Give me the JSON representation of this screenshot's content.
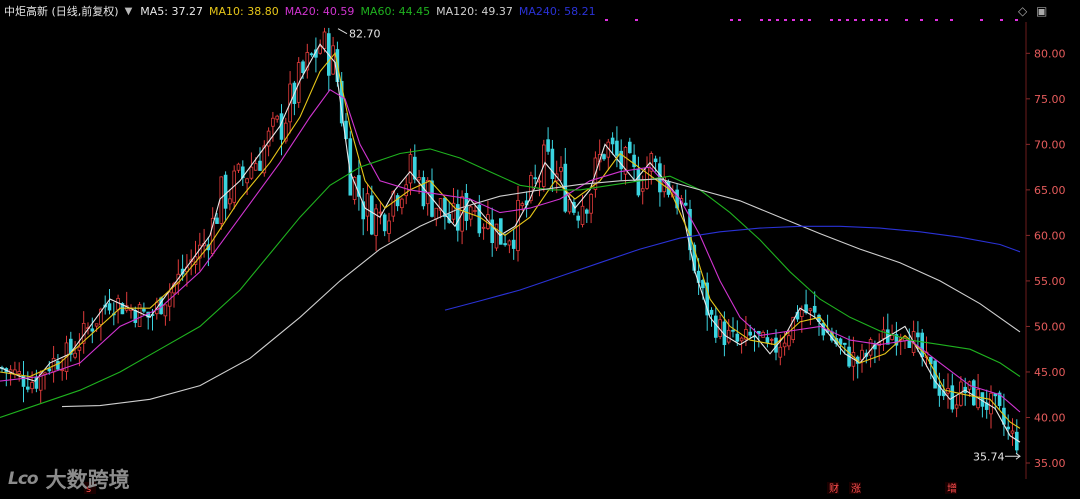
{
  "header": {
    "stock_name": "中炬高新 (日线,前复权)",
    "ma": [
      {
        "label": "MA5: 37.27",
        "color": "#e8e8e8"
      },
      {
        "label": "MA10: 38.80",
        "color": "#e6c619"
      },
      {
        "label": "MA20: 40.59",
        "color": "#d034d0"
      },
      {
        "label": "MA60: 44.45",
        "color": "#1fb21f"
      },
      {
        "label": "MA120: 49.37",
        "color": "#cfcfcf"
      },
      {
        "label": "MA240: 58.21",
        "color": "#2a32d6"
      }
    ]
  },
  "controls": {
    "diamond": "◇",
    "window": "▣"
  },
  "logo": {
    "mark": "Lco",
    "text": "大数跨境"
  },
  "chart_data": {
    "type": "candlestick",
    "ylim": [
      35,
      83
    ],
    "y_ticks": [
      "80.00",
      "75.00",
      "70.00",
      "65.00",
      "60.00",
      "55.00",
      "50.00",
      "45.00",
      "40.00",
      "35.00"
    ],
    "y_tick_values": [
      80,
      75,
      70,
      65,
      60,
      55,
      50,
      45,
      40,
      35
    ],
    "annotations": [
      {
        "text": "82.70",
        "price": 82.7
      },
      {
        "text": "35.74",
        "price": 35.74
      }
    ],
    "event_markers": [
      "s",
      "财",
      "涨",
      "增"
    ],
    "colors": {
      "up": "#e03b3b",
      "down": "#3bd4e0",
      "axis_text": "#e65c5c"
    },
    "ma_lines": [
      {
        "name": "MA5",
        "color": "#e8e8e8",
        "points": [
          [
            0,
            45.5
          ],
          [
            20,
            44.5
          ],
          [
            35,
            44
          ],
          [
            50,
            46
          ],
          [
            70,
            47
          ],
          [
            90,
            50
          ],
          [
            110,
            53
          ],
          [
            130,
            52
          ],
          [
            150,
            51
          ],
          [
            170,
            54
          ],
          [
            190,
            57
          ],
          [
            210,
            60
          ],
          [
            220,
            64
          ],
          [
            240,
            66
          ],
          [
            260,
            69
          ],
          [
            280,
            72
          ],
          [
            300,
            77
          ],
          [
            320,
            81
          ],
          [
            335,
            79
          ],
          [
            350,
            67
          ],
          [
            365,
            63
          ],
          [
            380,
            62
          ],
          [
            395,
            65
          ],
          [
            410,
            67
          ],
          [
            425,
            65
          ],
          [
            440,
            63
          ],
          [
            455,
            61
          ],
          [
            470,
            64
          ],
          [
            485,
            62
          ],
          [
            500,
            60
          ],
          [
            515,
            61
          ],
          [
            530,
            64
          ],
          [
            545,
            68
          ],
          [
            560,
            66
          ],
          [
            575,
            63
          ],
          [
            590,
            65
          ],
          [
            605,
            70
          ],
          [
            620,
            68
          ],
          [
            635,
            66
          ],
          [
            650,
            68
          ],
          [
            665,
            66
          ],
          [
            680,
            64
          ],
          [
            695,
            56
          ],
          [
            710,
            51
          ],
          [
            725,
            49
          ],
          [
            740,
            48
          ],
          [
            755,
            49
          ],
          [
            770,
            47
          ],
          [
            785,
            49
          ],
          [
            800,
            52
          ],
          [
            815,
            51
          ],
          [
            830,
            49
          ],
          [
            845,
            47
          ],
          [
            860,
            46
          ],
          [
            875,
            48
          ],
          [
            890,
            49
          ],
          [
            905,
            50
          ],
          [
            920,
            47
          ],
          [
            935,
            44
          ],
          [
            950,
            42
          ],
          [
            965,
            43
          ],
          [
            980,
            42
          ],
          [
            995,
            41
          ],
          [
            1010,
            38
          ],
          [
            1020,
            37.3
          ]
        ]
      },
      {
        "name": "MA10",
        "color": "#e6c619",
        "points": [
          [
            0,
            45
          ],
          [
            30,
            44.5
          ],
          [
            60,
            46
          ],
          [
            90,
            49
          ],
          [
            120,
            52
          ],
          [
            150,
            52
          ],
          [
            180,
            55
          ],
          [
            210,
            59
          ],
          [
            240,
            64
          ],
          [
            270,
            68
          ],
          [
            300,
            73
          ],
          [
            320,
            78
          ],
          [
            335,
            80
          ],
          [
            350,
            72
          ],
          [
            365,
            66
          ],
          [
            385,
            63
          ],
          [
            410,
            65
          ],
          [
            430,
            66
          ],
          [
            455,
            63
          ],
          [
            480,
            62
          ],
          [
            505,
            60
          ],
          [
            530,
            62
          ],
          [
            555,
            66
          ],
          [
            575,
            64
          ],
          [
            600,
            66
          ],
          [
            620,
            69
          ],
          [
            645,
            67
          ],
          [
            670,
            65
          ],
          [
            690,
            60
          ],
          [
            710,
            53
          ],
          [
            730,
            50
          ],
          [
            750,
            48.5
          ],
          [
            775,
            48
          ],
          [
            800,
            50.5
          ],
          [
            820,
            51
          ],
          [
            840,
            48
          ],
          [
            860,
            46
          ],
          [
            885,
            47
          ],
          [
            905,
            49
          ],
          [
            925,
            47
          ],
          [
            945,
            43
          ],
          [
            965,
            42.5
          ],
          [
            990,
            42
          ],
          [
            1010,
            39.5
          ],
          [
            1020,
            38.8
          ]
        ]
      },
      {
        "name": "MA20",
        "color": "#d034d0",
        "points": [
          [
            0,
            44
          ],
          [
            40,
            44.5
          ],
          [
            80,
            46
          ],
          [
            120,
            50
          ],
          [
            160,
            52
          ],
          [
            200,
            56
          ],
          [
            240,
            62
          ],
          [
            280,
            68
          ],
          [
            310,
            73
          ],
          [
            330,
            76
          ],
          [
            345,
            75
          ],
          [
            360,
            70
          ],
          [
            380,
            66
          ],
          [
            410,
            65
          ],
          [
            440,
            64.5
          ],
          [
            470,
            64
          ],
          [
            500,
            62.5
          ],
          [
            530,
            63
          ],
          [
            560,
            64
          ],
          [
            590,
            66
          ],
          [
            620,
            67
          ],
          [
            650,
            67.5
          ],
          [
            680,
            64
          ],
          [
            700,
            60
          ],
          [
            720,
            55
          ],
          [
            740,
            51
          ],
          [
            760,
            49
          ],
          [
            790,
            49.5
          ],
          [
            820,
            50
          ],
          [
            850,
            48.5
          ],
          [
            880,
            48
          ],
          [
            910,
            48.5
          ],
          [
            940,
            46
          ],
          [
            970,
            43.5
          ],
          [
            1000,
            42.5
          ],
          [
            1020,
            40.6
          ]
        ]
      },
      {
        "name": "MA60",
        "color": "#1fb21f",
        "points": [
          [
            0,
            40
          ],
          [
            40,
            41.5
          ],
          [
            80,
            43
          ],
          [
            120,
            45
          ],
          [
            160,
            47.5
          ],
          [
            200,
            50
          ],
          [
            240,
            54
          ],
          [
            270,
            58
          ],
          [
            300,
            62
          ],
          [
            330,
            65.5
          ],
          [
            360,
            67.5
          ],
          [
            400,
            69
          ],
          [
            430,
            69.5
          ],
          [
            460,
            68.5
          ],
          [
            490,
            67
          ],
          [
            520,
            65.5
          ],
          [
            550,
            65
          ],
          [
            580,
            65
          ],
          [
            610,
            65.5
          ],
          [
            640,
            66
          ],
          [
            670,
            66.5
          ],
          [
            700,
            65
          ],
          [
            730,
            62.5
          ],
          [
            760,
            59.5
          ],
          [
            790,
            56
          ],
          [
            820,
            53
          ],
          [
            850,
            51
          ],
          [
            880,
            49.5
          ],
          [
            910,
            48.5
          ],
          [
            940,
            48
          ],
          [
            970,
            47.5
          ],
          [
            1000,
            46
          ],
          [
            1020,
            44.5
          ]
        ]
      },
      {
        "name": "MA120",
        "color": "#cfcfcf",
        "points": [
          [
            62,
            41.2
          ],
          [
            100,
            41.3
          ],
          [
            150,
            42
          ],
          [
            200,
            43.5
          ],
          [
            250,
            46.5
          ],
          [
            300,
            51
          ],
          [
            340,
            55
          ],
          [
            380,
            58.5
          ],
          [
            420,
            61
          ],
          [
            460,
            63
          ],
          [
            500,
            64.3
          ],
          [
            540,
            65
          ],
          [
            580,
            65.6
          ],
          [
            620,
            66
          ],
          [
            660,
            66.2
          ],
          [
            700,
            65
          ],
          [
            740,
            63.8
          ],
          [
            780,
            62
          ],
          [
            820,
            60.2
          ],
          [
            860,
            58.5
          ],
          [
            900,
            57
          ],
          [
            940,
            55
          ],
          [
            980,
            52.5
          ],
          [
            1020,
            49.4
          ]
        ]
      },
      {
        "name": "MA240",
        "color": "#2a32d6",
        "points": [
          [
            445,
            51.8
          ],
          [
            480,
            52.8
          ],
          [
            520,
            54
          ],
          [
            560,
            55.5
          ],
          [
            600,
            57
          ],
          [
            640,
            58.5
          ],
          [
            680,
            59.7
          ],
          [
            720,
            60.4
          ],
          [
            760,
            60.8
          ],
          [
            800,
            61
          ],
          [
            840,
            61
          ],
          [
            880,
            60.8
          ],
          [
            920,
            60.4
          ],
          [
            960,
            59.8
          ],
          [
            1000,
            59
          ],
          [
            1020,
            58.2
          ]
        ]
      }
    ]
  }
}
